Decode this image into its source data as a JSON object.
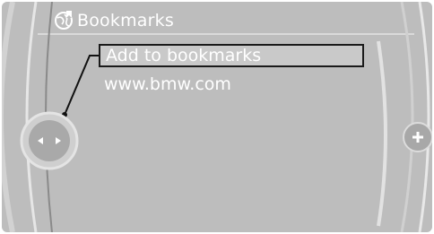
{
  "header": {
    "title": "Bookmarks",
    "icon": "globe-bookmark-icon"
  },
  "menu": {
    "items": [
      {
        "label": "Add to bookmarks",
        "selected": true
      },
      {
        "label": "www.bmw.com",
        "selected": false
      }
    ]
  },
  "controls": {
    "left_knob_icon": "left-right-arrows-icon",
    "right_knob_icon": "plus-icon"
  },
  "colors": {
    "background": "#bdbdbd",
    "text": "#ffffff",
    "selection_border": "#1a1a1a"
  }
}
